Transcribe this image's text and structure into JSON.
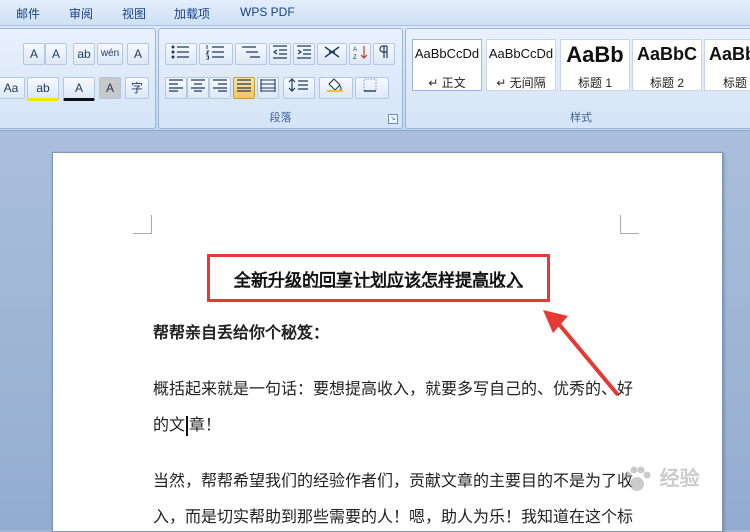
{
  "menu": [
    "邮件",
    "审阅",
    "视图",
    "加载项",
    "WPS PDF"
  ],
  "ribbon": {
    "font_row1": [
      "A",
      "A",
      "ab",
      "wén",
      "A"
    ],
    "font_row2": [
      "Aa",
      "ab",
      "A",
      "A",
      "字"
    ],
    "paragraph_label": "段落",
    "styles_label": "样式",
    "styles": [
      {
        "sample": "AaBbCcDd",
        "name": "↵ 正文"
      },
      {
        "sample": "AaBbCcDd",
        "name": "↵ 无间隔"
      },
      {
        "sample": "AaBb",
        "name": "标题 1"
      },
      {
        "sample": "AaBbC",
        "name": "标题 2"
      },
      {
        "sample": "AaBb",
        "name": "标题"
      }
    ]
  },
  "document": {
    "title": "全新升级的回享计划应该怎样提高收入",
    "subheading": "帮帮亲自丢给你个秘笈：",
    "p1_line1": "概括起来就是一句话：要想提高收入，就要多写自己的、优秀的、好",
    "p1_line2a": "的文",
    "p1_line2b": "章！",
    "p2_line1": "当然，帮帮希望我们的经验作者们，贡献文章的主要目的不是为了收",
    "p2_line2": "入，而是切实帮助到那些需要的人！嗯，助人为乐！我知道在这个标"
  },
  "watermark": {
    "text": "经验",
    "accent": "#e53935"
  }
}
